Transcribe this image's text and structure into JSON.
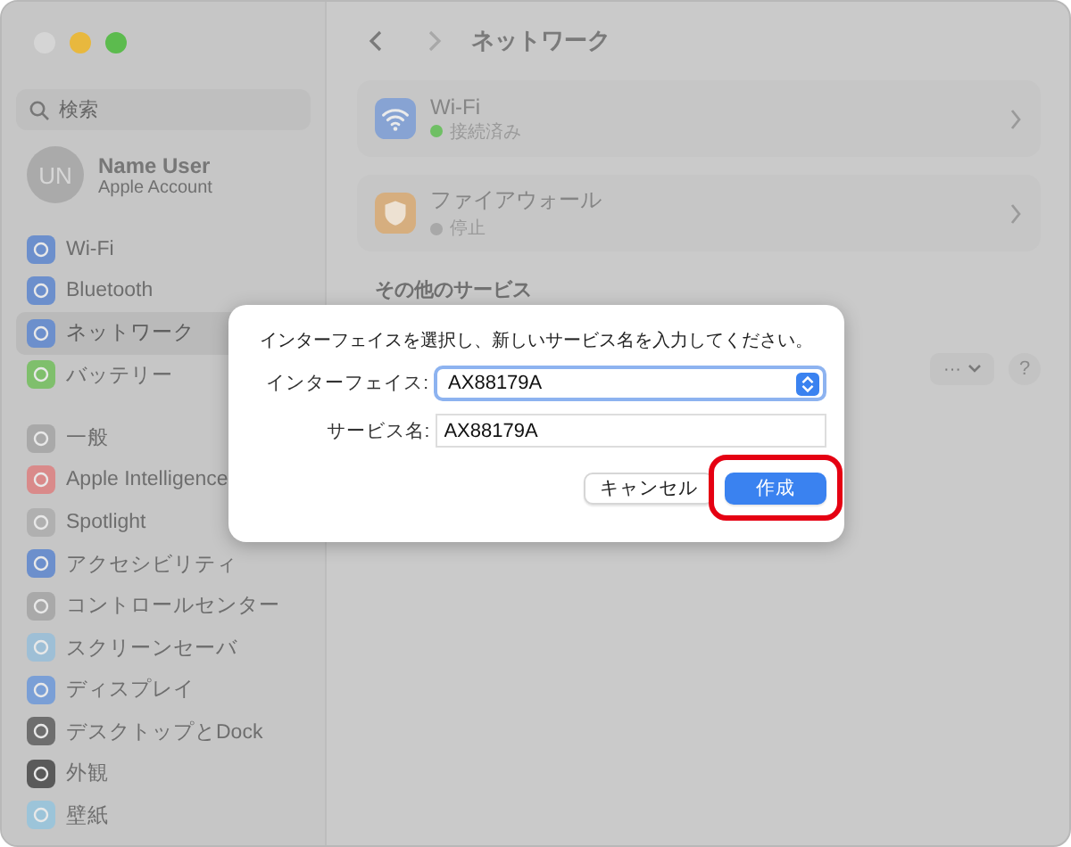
{
  "sidebar": {
    "search": {
      "placeholder": "検索"
    },
    "account": {
      "initials": "UN",
      "name": "Name User",
      "subtitle": "Apple Account"
    },
    "groups": [
      [
        {
          "label": "Wi-Fi",
          "color": "#6c8fcc",
          "selected": false
        },
        {
          "label": "Bluetooth",
          "color": "#6c8fcc",
          "selected": false
        },
        {
          "label": "ネットワーク",
          "color": "#6c8fcc",
          "selected": true
        },
        {
          "label": "バッテリー",
          "color": "#7fbf6c",
          "selected": false
        }
      ],
      [
        {
          "label": "一般",
          "color": "#a9a9a9",
          "selected": false
        },
        {
          "label": "Apple Intelligence",
          "color": "#d98a8a",
          "selected": false
        },
        {
          "label": "Spotlight",
          "color": "#b0b0b0",
          "selected": false
        },
        {
          "label": "アクセシビリティ",
          "color": "#6c8fcc",
          "selected": false
        },
        {
          "label": "コントロールセンター",
          "color": "#a9a9a9",
          "selected": false
        },
        {
          "label": "スクリーンセーバ",
          "color": "#9ebfd6",
          "selected": false
        },
        {
          "label": "ディスプレイ",
          "color": "#7a9fd6",
          "selected": false
        },
        {
          "label": "デスクトップとDock",
          "color": "#6e6e6e",
          "selected": false
        },
        {
          "label": "外観",
          "color": "#5a5a5a",
          "selected": false
        },
        {
          "label": "壁紙",
          "color": "#9cc4d9",
          "selected": false
        }
      ]
    ]
  },
  "main": {
    "title": "ネットワーク",
    "services": [
      {
        "kind": "wifi",
        "name": "Wi-Fi",
        "status": "接続済み",
        "active": true
      },
      {
        "kind": "firewall",
        "name": "ファイアウォール",
        "status": "停止",
        "active": false
      }
    ],
    "section_heading": "その他のサービス",
    "more_button": "···",
    "help_button": "?"
  },
  "dialog": {
    "message": "インターフェイスを選択し、新しいサービス名を入力してください。",
    "fields": [
      {
        "kind": "select",
        "label": "インターフェイス:",
        "value": "AX88179A"
      },
      {
        "kind": "text",
        "label": "サービス名:",
        "value": "AX88179A"
      }
    ],
    "buttons": [
      {
        "label": "キャンセル",
        "primary": false,
        "highlighted": false
      },
      {
        "label": "作成",
        "primary": true,
        "highlighted": true
      }
    ]
  }
}
